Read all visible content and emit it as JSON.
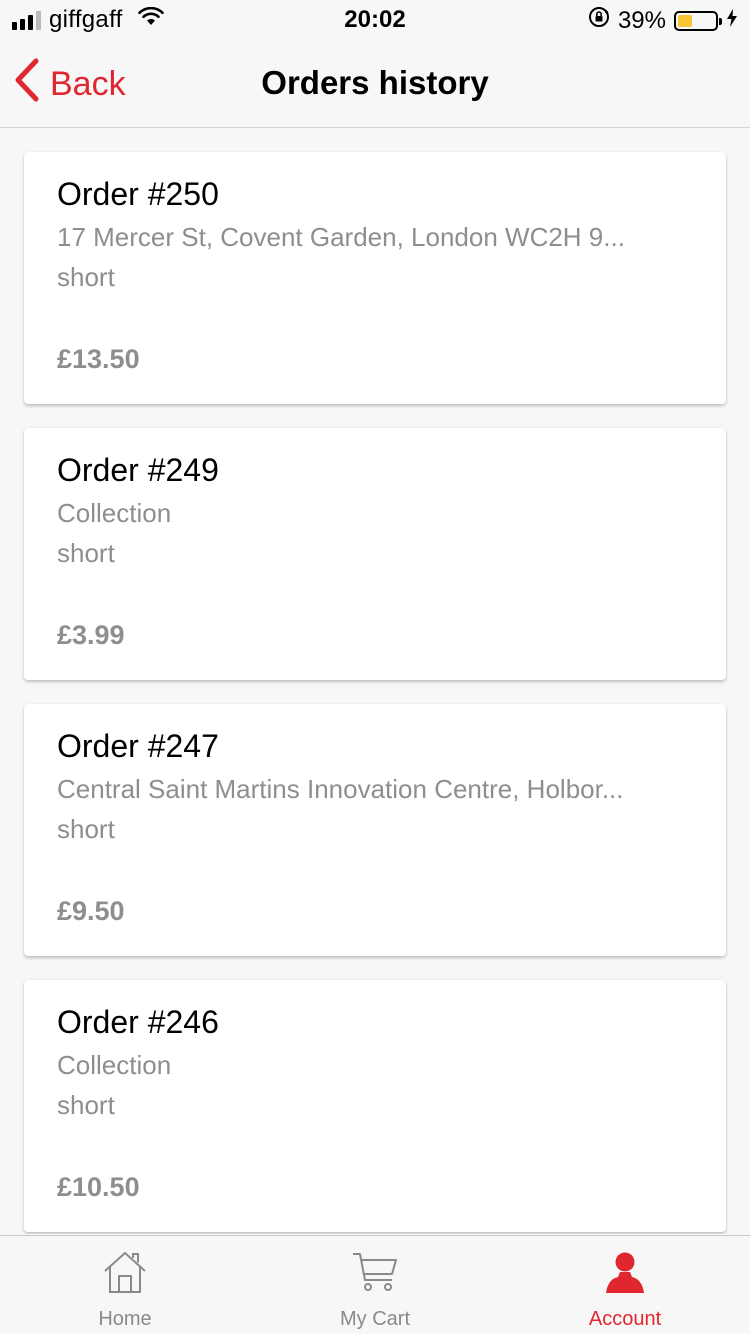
{
  "status_bar": {
    "carrier": "giffgaff",
    "time": "20:02",
    "battery_percent": "39%",
    "battery_level": 0.39,
    "signal_bars_on": 3,
    "signal_bars_total": 4,
    "icons": [
      "signal-icon",
      "wifi-icon",
      "orientation-lock-icon",
      "battery-icon",
      "charging-icon"
    ]
  },
  "nav": {
    "back_label": "Back",
    "title": "Orders history",
    "back_icon": "chevron-left-icon"
  },
  "orders": [
    {
      "title": "Order #250",
      "address": "17 Mercer St, Covent Garden, London WC2H 9...",
      "type": "short",
      "price": "£13.50"
    },
    {
      "title": "Order #249",
      "address": "Collection",
      "type": "short",
      "price": "£3.99"
    },
    {
      "title": "Order #247",
      "address": "Central Saint Martins Innovation Centre, Holbor...",
      "type": "short",
      "price": "£9.50"
    },
    {
      "title": "Order #246",
      "address": "Collection",
      "type": "short",
      "price": "£10.50"
    }
  ],
  "tabs": [
    {
      "label": "Home",
      "icon": "home-icon",
      "active": false
    },
    {
      "label": "My Cart",
      "icon": "cart-icon",
      "active": false
    },
    {
      "label": "Account",
      "icon": "person-icon",
      "active": true
    }
  ],
  "colors": {
    "accent": "#e0262f",
    "secondary_text": "#8e8e8e",
    "background": "#f7f7f7",
    "battery_fill": "#f6c531"
  }
}
